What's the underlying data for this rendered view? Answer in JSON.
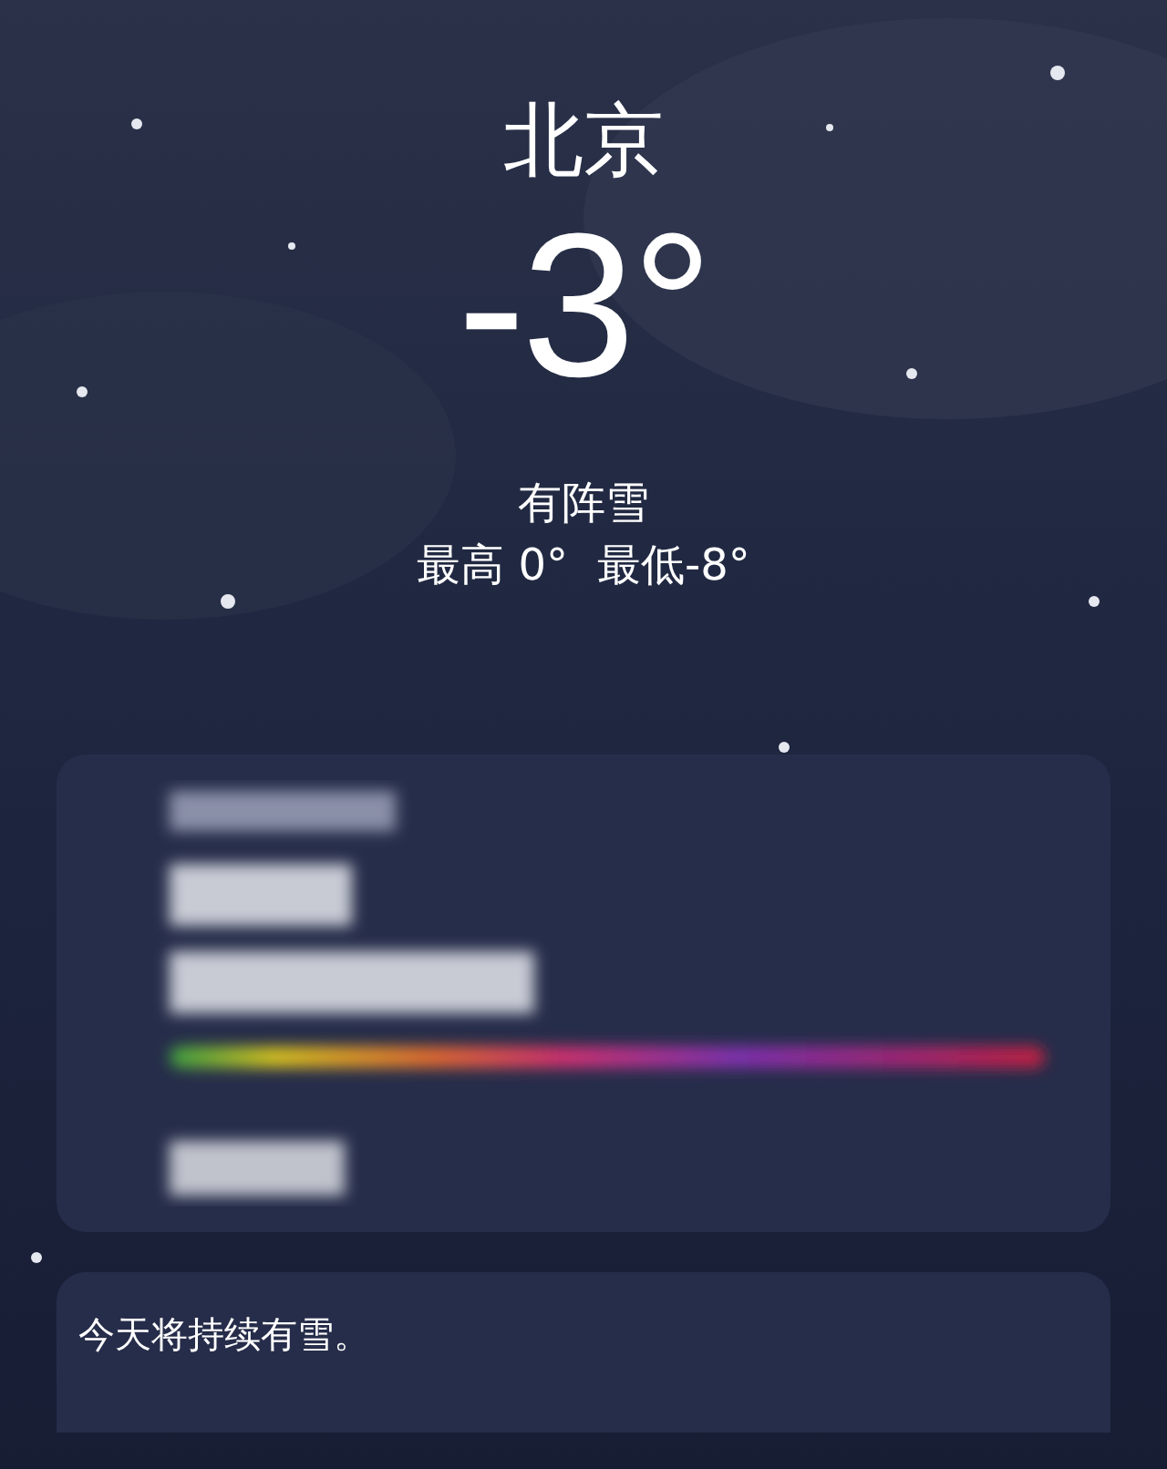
{
  "location": {
    "city": "北京",
    "temperature": "-3°",
    "condition": "有阵雪",
    "high": "最高 0°",
    "low": "最低-8°"
  },
  "summary": {
    "text": "今天将持续有雪。"
  }
}
